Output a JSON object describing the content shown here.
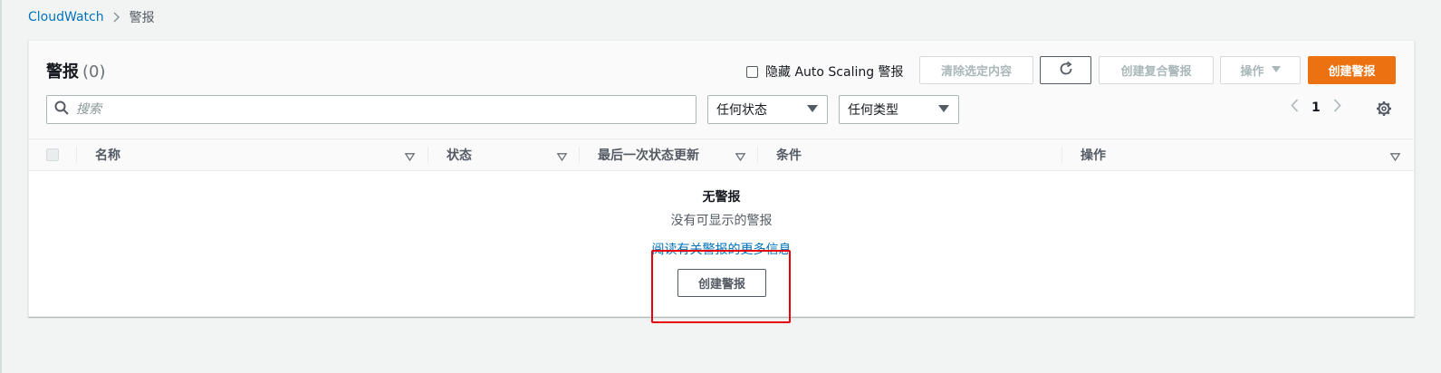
{
  "breadcrumb": {
    "root": "CloudWatch",
    "current": "警报"
  },
  "header": {
    "title": "警报",
    "count": "(0)",
    "hide_autoscaling_label": "隐藏 Auto Scaling 警报",
    "clear_label": "清除选定内容",
    "create_composite_label": "创建复合警报",
    "actions_label": "操作",
    "create_alarm_label": "创建警报"
  },
  "filters": {
    "search_placeholder": "搜索",
    "state_select": "任何状态",
    "type_select": "任何类型"
  },
  "pagination": {
    "page": "1"
  },
  "table": {
    "columns": [
      "名称",
      "状态",
      "最后一次状态更新",
      "条件",
      "操作"
    ]
  },
  "empty_state": {
    "title": "无警报",
    "subtitle": "没有可显示的警报",
    "link": "阅读有关警报的更多信息",
    "button": "创建警报"
  },
  "colors": {
    "primary": "#ec7211",
    "link": "#0073bb",
    "highlight": "#e8000b"
  },
  "icons": [
    "chevron-right-icon",
    "refresh-icon",
    "caret-down-icon",
    "search-icon",
    "chevron-left-icon",
    "settings-icon",
    "sort-icon"
  ]
}
